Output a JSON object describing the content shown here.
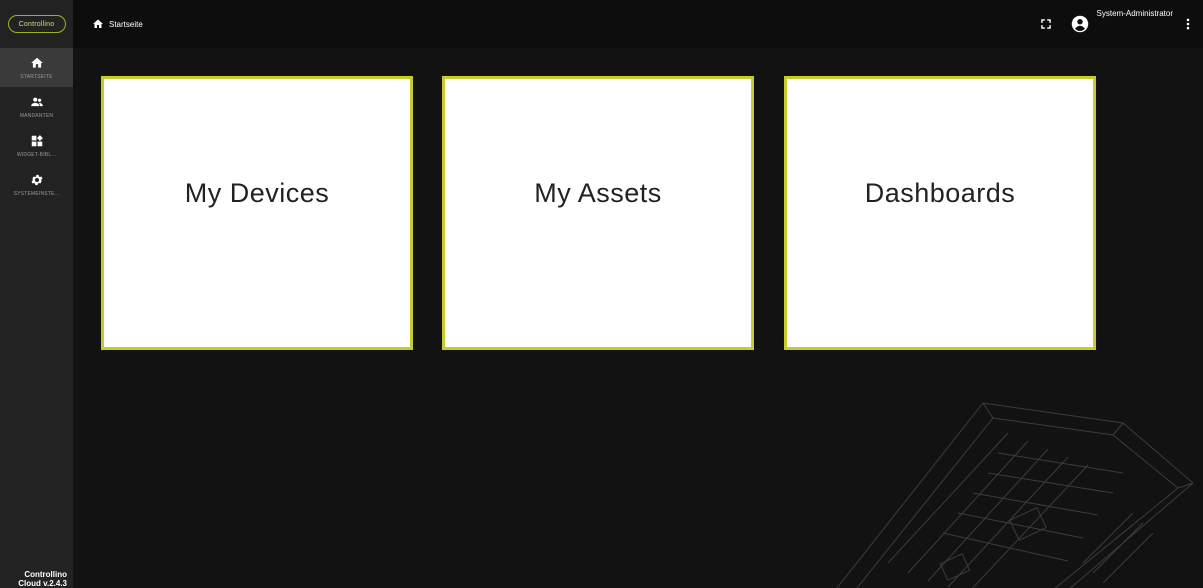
{
  "brand": {
    "logo_text": "Controllino",
    "accent_color": "#c5cc2b",
    "footer_line1": "Controllino",
    "footer_line2": "Cloud v.2.4.3"
  },
  "sidebar": {
    "items": [
      {
        "label": "Startseite",
        "icon": "home-icon",
        "active": true
      },
      {
        "label": "Mandanten",
        "icon": "users-icon",
        "active": false
      },
      {
        "label": "Widget-Bibl...",
        "icon": "widgets-icon",
        "active": false
      },
      {
        "label": "Systemeinste...",
        "icon": "gear-icon",
        "active": false
      }
    ]
  },
  "header": {
    "breadcrumb": "Startseite",
    "user_name": "System-Administrator"
  },
  "tiles": [
    {
      "label": "My Devices"
    },
    {
      "label": "My Assets"
    },
    {
      "label": "Dashboards"
    }
  ]
}
